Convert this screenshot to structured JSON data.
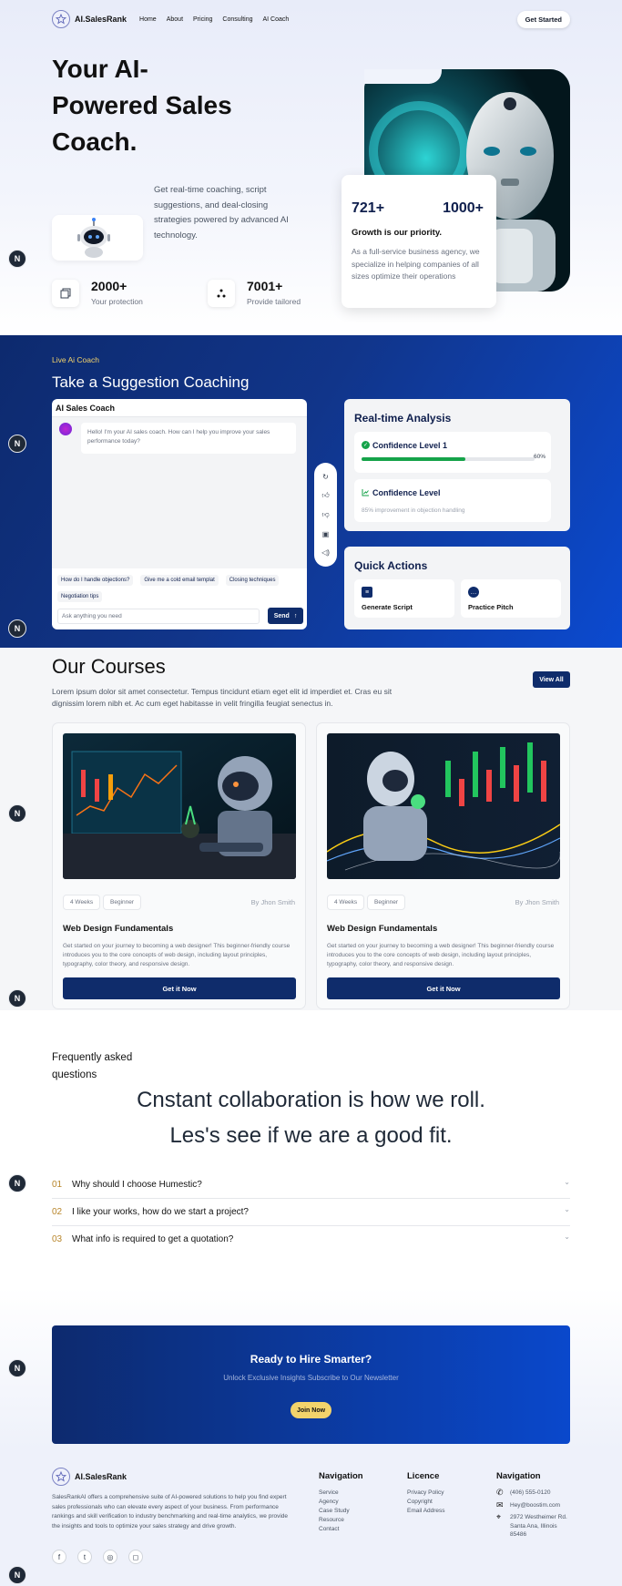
{
  "nav": {
    "logo": "AI.SalesRank",
    "links": [
      "Home",
      "About",
      "Pricing",
      "Consulting",
      "AI Coach"
    ],
    "cta": "Get Started"
  },
  "hero": {
    "title": "Your AI-Powered Sales Coach.",
    "description": "Get real-time coaching, script suggestions, and deal-closing strategies powered by advanced AI technology.",
    "stats": [
      {
        "value": "2000+",
        "label": "Your protection"
      },
      {
        "value": "7001+",
        "label": "Provide tailored"
      }
    ],
    "growth": {
      "num1": "721+",
      "num2": "1000+",
      "title": "Growth is our priority.",
      "desc": "As a full-service business agency, we specialize in helping companies of all sizes optimize their operations"
    }
  },
  "coach": {
    "eyebrow": "Live Ai Coach",
    "title": "Take a Suggestion Coaching",
    "chat": {
      "header": "AI Sales Coach",
      "message": "Hello! I'm your AI sales coach. How can I help you improve your sales performance today?",
      "suggestions": [
        "How do I handle objections?",
        "Give me a cold email templat",
        "Closing techniques",
        "Negotiation tips"
      ],
      "placeholder": "Ask anything you need",
      "send": "Send"
    },
    "analysis": {
      "title": "Real-time Analysis",
      "conf1_label": "Confidence Level 1",
      "conf1_value": 60,
      "conf1_pct": "60%",
      "conf2_label": "Confidence Level",
      "conf2_desc": "85% improvement in objection handling"
    },
    "quick": {
      "title": "Quick Actions",
      "actions": [
        "Generate Script",
        "Practice Pitch"
      ]
    }
  },
  "courses": {
    "title": "Our Courses",
    "desc": "Lorem ipsum dolor sit amet consectetur. Tempus tincidunt etiam eget elit id imperdiet et. Cras eu sit dignissim lorem nibh et. Ac cum eget habitasse in velit fringilla feugiat senectus in.",
    "view_all": "View All",
    "items": [
      {
        "weeks": "4 Weeks",
        "level": "Beginner",
        "by": "By Jhon Smith",
        "title": "Web Design Fundamentals",
        "desc": "Get started on your journey to becoming a web designer! This beginner-friendly course introduces you to the core concepts of web design, including layout principles, typography, color theory, and responsive design.",
        "cta": "Get it Now"
      },
      {
        "weeks": "4 Weeks",
        "level": "Beginner",
        "by": "By Jhon Smith",
        "title": "Web Design Fundamentals",
        "desc": "Get started on your journey to becoming a web designer! This beginner-friendly course introduces you to the core concepts of web design, including layout principles, typography, color theory, and responsive design.",
        "cta": "Get it Now"
      }
    ]
  },
  "faq": {
    "label": "Frequently asked questions",
    "line1": "Cnstant collaboration is how we roll.",
    "line2": "Les's see if we are a good fit.",
    "items": [
      {
        "num": "01",
        "q": "Why should I choose Humestic?"
      },
      {
        "num": "02",
        "q": "I like your works, how do we start a project?"
      },
      {
        "num": "03",
        "q": "What info is required to get a quotation?"
      }
    ]
  },
  "cta": {
    "title": "Ready to Hire Smarter?",
    "desc": "Unlock Exclusive Insights Subscribe to Our Newsletter",
    "button": "Join Now"
  },
  "footer": {
    "logo": "AI.SalesRank",
    "desc": "SalesRankAI offers a comprehensive suite of AI-powered solutions to help you find expert sales professionals who can elevate every aspect of your business. From performance rankings and skill verification to industry benchmarking and real-time analytics, we provide the insights and tools to optimize your sales strategy and drive growth.",
    "nav_title": "Navigation",
    "nav_links": [
      "Service",
      "Agency",
      "Case Study",
      "Resource",
      "Contact"
    ],
    "licence_title": "Licence",
    "licence_links": [
      "Privacy Policy",
      "Copyright",
      "Email Address"
    ],
    "contact_title": "Navigation",
    "phone": "(406) 555-0120",
    "email": "Hey@boostim.com",
    "address": "2972 Westheimer Rd. Santa Ana, Illinois 85486"
  },
  "side_badge": "N"
}
